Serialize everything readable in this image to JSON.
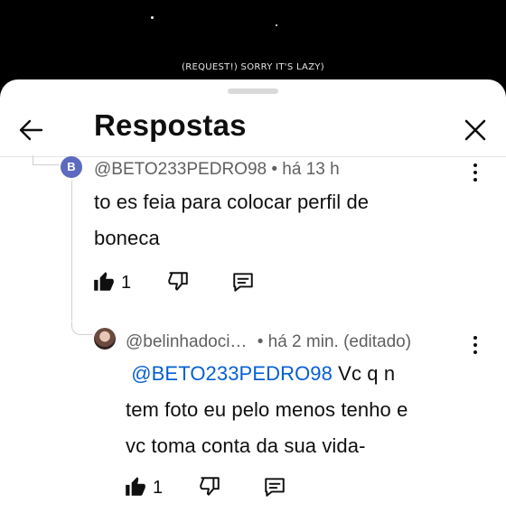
{
  "video": {
    "caption": "(REQUEST!) SORRY IT'S LAZY)"
  },
  "panel": {
    "title": "Respostas"
  },
  "comments": [
    {
      "avatar_letter": "B",
      "author": "@BETO233PEDRO98",
      "time": "• há 13 h",
      "text_line1": "to es feia para colocar perfil de",
      "text_line2": "boneca",
      "likes": "1"
    },
    {
      "author": "@belinhadoci…",
      "time": "• há 2 min. (editado)",
      "mention": "@BETO233PEDRO98",
      "text_line1_rest": " Vc q n",
      "text_line2": "tem foto eu pelo menos tenho e",
      "text_line3": "vc toma conta da sua vida-",
      "likes": "1"
    }
  ]
}
